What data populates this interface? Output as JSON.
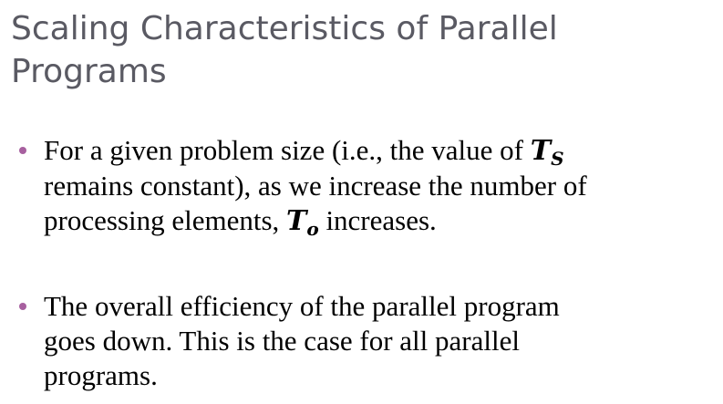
{
  "slide": {
    "title": "Scaling Characteristics of Parallel Programs",
    "bullets": [
      {
        "lines": [
          {
            "before": "For a given problem size (i.e., the value of ",
            "math": {
              "base": "T",
              "sub": "S"
            }
          },
          {
            "text": "remains constant), as we increase the number of"
          },
          {
            "before": "processing elements, ",
            "math": {
              "base": "T",
              "sub": "o"
            },
            "after": " increases."
          }
        ]
      },
      {
        "lines": [
          {
            "text": "The overall efficiency of the parallel program"
          },
          {
            "text": "goes down. This is the case for all parallel"
          },
          {
            "text": "programs."
          }
        ]
      }
    ],
    "colors": {
      "title": "#5a5a63",
      "bullet_marker": "#a7609f",
      "body_text": "#000000",
      "background": "#ffffff"
    }
  }
}
